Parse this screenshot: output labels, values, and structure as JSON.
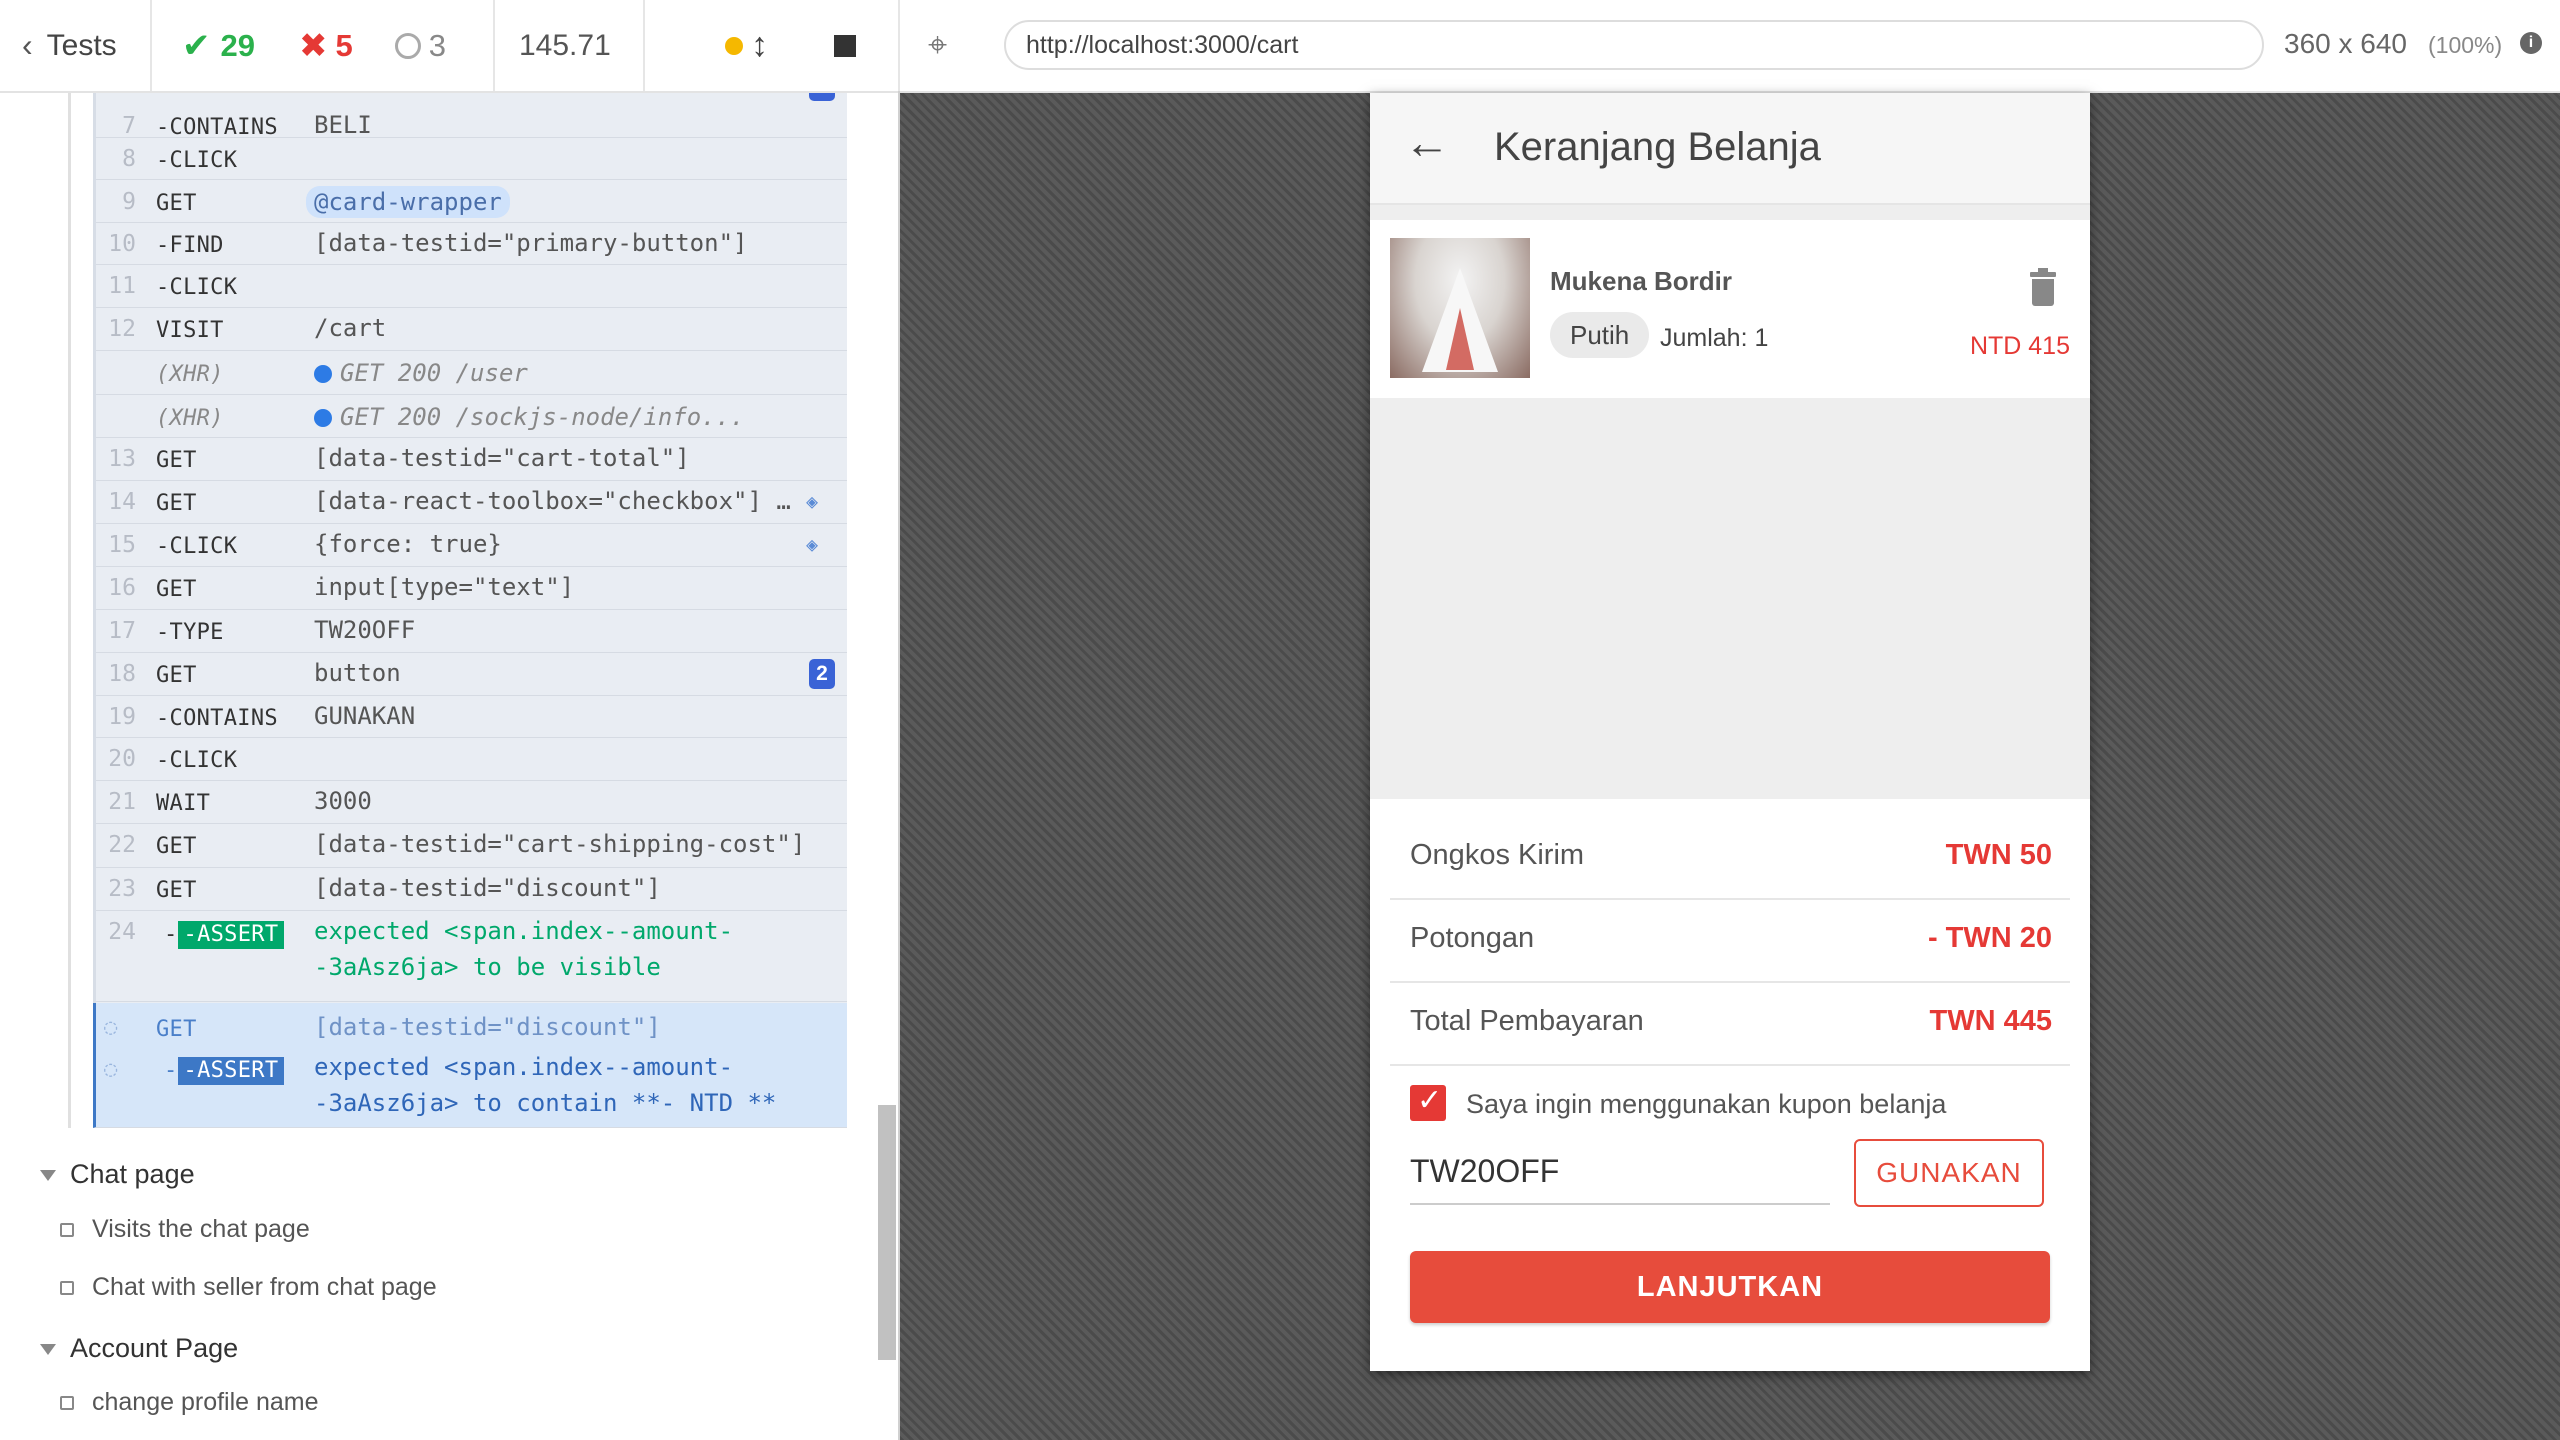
{
  "topbar": {
    "back_label": "Tests",
    "passed": "29",
    "failed": "5",
    "pending": "3",
    "duration": "145.71",
    "url": "http://localhost:3000/cart",
    "viewport": "360 x 640",
    "zoom": "(100%)"
  },
  "commands": [
    {
      "ln": "7",
      "cmd": "-CONTAINS",
      "arg": "BELI"
    },
    {
      "ln": "8",
      "cmd": "-CLICK",
      "arg": ""
    },
    {
      "ln": "9",
      "cmd": "GET",
      "arg": "@card-wrapper"
    },
    {
      "ln": "10",
      "cmd": "-FIND",
      "arg": "[data-testid=\"primary-button\"]"
    },
    {
      "ln": "11",
      "cmd": "-CLICK",
      "arg": ""
    },
    {
      "ln": "12",
      "cmd": "VISIT",
      "arg": "/cart"
    },
    {
      "ln": "",
      "cmd": "(XHR)",
      "arg": "GET 200 /user"
    },
    {
      "ln": "",
      "cmd": "(XHR)",
      "arg": "GET 200 /sockjs-node/info..."
    },
    {
      "ln": "13",
      "cmd": "GET",
      "arg": "[data-testid=\"cart-total\"]"
    },
    {
      "ln": "14",
      "cmd": "GET",
      "arg": "[data-react-toolbox=\"checkbox\"] …"
    },
    {
      "ln": "15",
      "cmd": "-CLICK",
      "arg": "{force: true}"
    },
    {
      "ln": "16",
      "cmd": "GET",
      "arg": "input[type=\"text\"]"
    },
    {
      "ln": "17",
      "cmd": "-TYPE",
      "arg": "TW20OFF"
    },
    {
      "ln": "18",
      "cmd": "GET",
      "arg": "button"
    },
    {
      "ln": "19",
      "cmd": "-CONTAINS",
      "arg": "GUNAKAN"
    },
    {
      "ln": "20",
      "cmd": "-CLICK",
      "arg": ""
    },
    {
      "ln": "21",
      "cmd": "WAIT",
      "arg": "3000"
    },
    {
      "ln": "22",
      "cmd": "GET",
      "arg": "[data-testid=\"cart-shipping-cost\"]"
    },
    {
      "ln": "23",
      "cmd": "GET",
      "arg": "[data-testid=\"discount\"]"
    },
    {
      "ln": "24",
      "cmd": "-ASSERT",
      "arg": "expected <span.index--amount-",
      "arg2": "-3aAsz6ja> to be visible"
    },
    {
      "ln": "",
      "cmd": "GET",
      "arg": "[data-testid=\"discount\"]"
    },
    {
      "ln": "",
      "cmd": "-ASSERT",
      "arg": "expected <span.index--amount-",
      "arg2": "-3aAsz6ja> to contain **- NTD **"
    }
  ],
  "badge_count": "2",
  "suites": [
    {
      "title": "Chat page",
      "tests": [
        "Visits the chat page",
        "Chat with seller from chat page"
      ]
    },
    {
      "title": "Account Page",
      "tests": [
        "change profile name"
      ]
    }
  ],
  "app": {
    "title": "Keranjang Belanja",
    "product_name": "Mukena Bordir",
    "product_variant": "Putih",
    "product_qty": "Jumlah: 1",
    "product_price": "NTD 415",
    "shipping_label": "Ongkos Kirim",
    "shipping_value": "TWN 50",
    "discount_label": "Potongan",
    "discount_value": "- TWN 20",
    "total_label": "Total Pembayaran",
    "total_value": "TWN 445",
    "coupon_checkbox_label": "Saya ingin menggunakan kupon belanja",
    "coupon_code": "TW20OFF",
    "apply_label": "GUNAKAN",
    "continue_label": "LANJUTKAN"
  },
  "colors": {
    "pass": "#2bb14c",
    "fail": "#e53935",
    "accent": "#e74c3c",
    "assert": "#00a86b"
  }
}
